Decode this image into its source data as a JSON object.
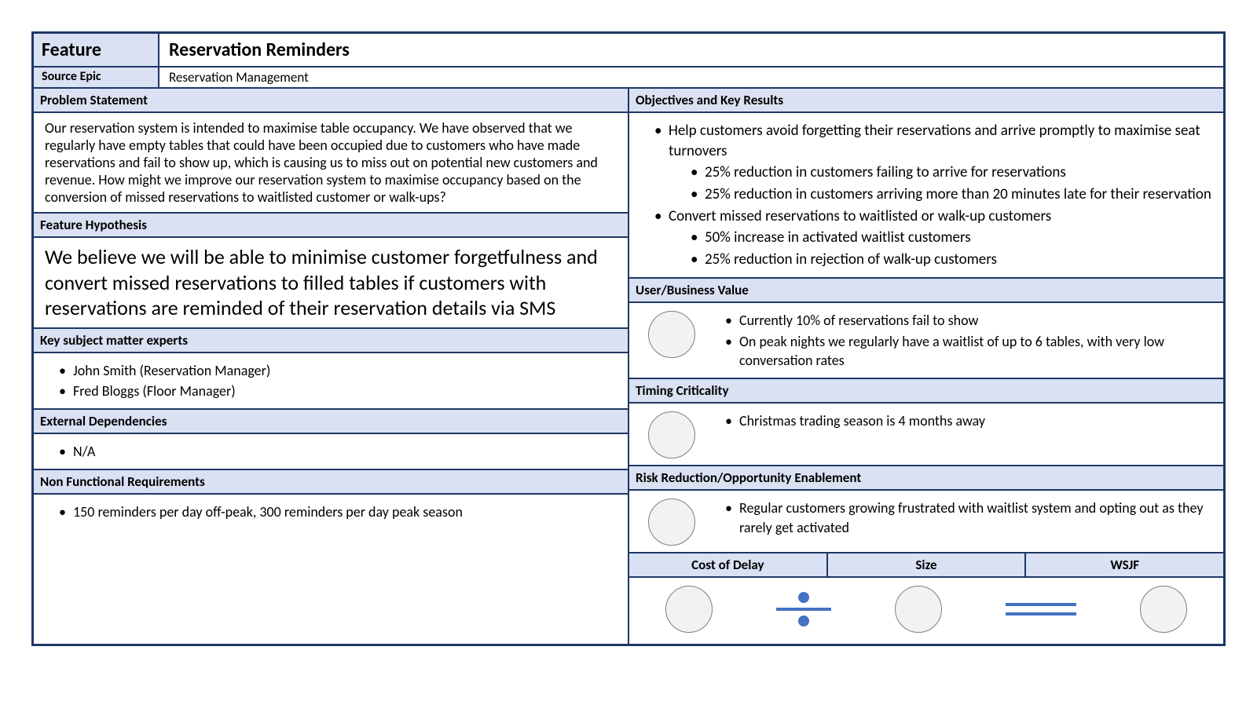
{
  "feature": {
    "label": "Feature",
    "value": "Reservation Reminders"
  },
  "source_epic": {
    "label": "Source Epic",
    "value": "Reservation Management"
  },
  "left": {
    "problem_header": "Problem Statement",
    "problem_text": "Our reservation system is intended to maximise table occupancy. We have observed that we regularly have empty tables that could have been occupied due to customers who have made reservations and fail to show up, which is causing us to miss out on potential new customers and revenue.  How might we improve our reservation system to maximise occupancy based on the conversion of missed reservations to waitlisted customer or walk-ups?",
    "hypothesis_header": "Feature Hypothesis",
    "hypothesis_text": "We believe we will be able to minimise customer forgetfulness and convert missed reservations to filled tables if customers with reservations are reminded of their reservation details via SMS",
    "sme_header": "Key subject matter experts",
    "sme_1": "John Smith (Reservation Manager)",
    "sme_2": "Fred Bloggs (Floor Manager)",
    "ext_header": "External Dependencies",
    "ext_1": "N/A",
    "nfr_header": "Non Functional Requirements",
    "nfr_1": "150 reminders per day off-peak, 300 reminders per day peak season"
  },
  "right": {
    "okr_header": "Objectives and Key Results",
    "okr_obj1": "Help customers avoid forgetting their reservations and arrive promptly to maximise seat turnovers",
    "okr_obj1_kr1": "25% reduction in customers failing to arrive for reservations",
    "okr_obj1_kr2": "25% reduction in customers arriving more than 20 minutes late for their reservation",
    "okr_obj2": "Convert missed reservations to waitlisted or walk-up customers",
    "okr_obj2_kr1": "50% increase in activated waitlist customers",
    "okr_obj2_kr2": "25% reduction in rejection of walk-up customers",
    "ubv_header": "User/Business Value",
    "ubv_1": "Currently 10% of reservations fail to show",
    "ubv_2": "On peak nights we regularly have a waitlist of up to 6 tables, with very low conversation rates",
    "timing_header": "Timing Criticality",
    "timing_1": "Christmas trading season is 4 months away",
    "risk_header": "Risk Reduction/Opportunity Enablement",
    "risk_1": "Regular customers growing frustrated with waitlist system and opting out as they rarely get activated",
    "calc": {
      "cod": "Cost of Delay",
      "size": "Size",
      "wsjf": "WSJF"
    }
  }
}
